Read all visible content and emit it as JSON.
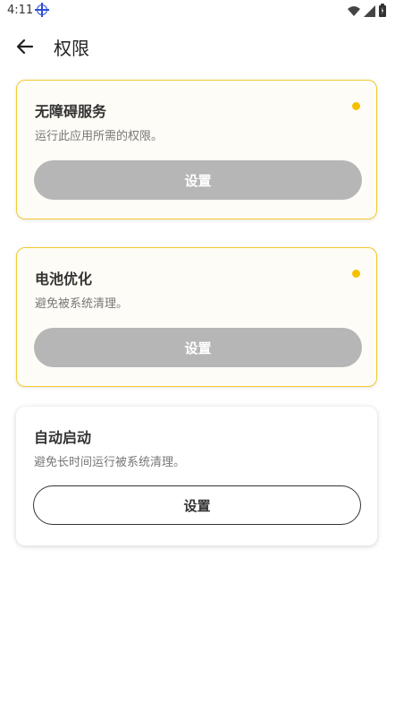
{
  "status_bar": {
    "time": "4:11",
    "icons": [
      "location-target-icon",
      "wifi-icon",
      "signal-icon",
      "battery-charging-icon"
    ],
    "accent_color": "#2f4dd3"
  },
  "app_bar": {
    "back_icon": "arrow-left-icon",
    "title": "权限"
  },
  "colors": {
    "highlight_border": "#f4c92e",
    "status_dot": "#f5c000",
    "disabled_button": "#b6b6b6"
  },
  "permissions": [
    {
      "title": "无障碍服务",
      "description": "运行此应用所需的权限。",
      "button_label": "设置",
      "pending": true
    },
    {
      "title": "电池优化",
      "description": "避免被系统清理。",
      "button_label": "设置",
      "pending": true
    },
    {
      "title": "自动启动",
      "description": "避免长时间运行被系统清理。",
      "button_label": "设置",
      "pending": false
    }
  ]
}
